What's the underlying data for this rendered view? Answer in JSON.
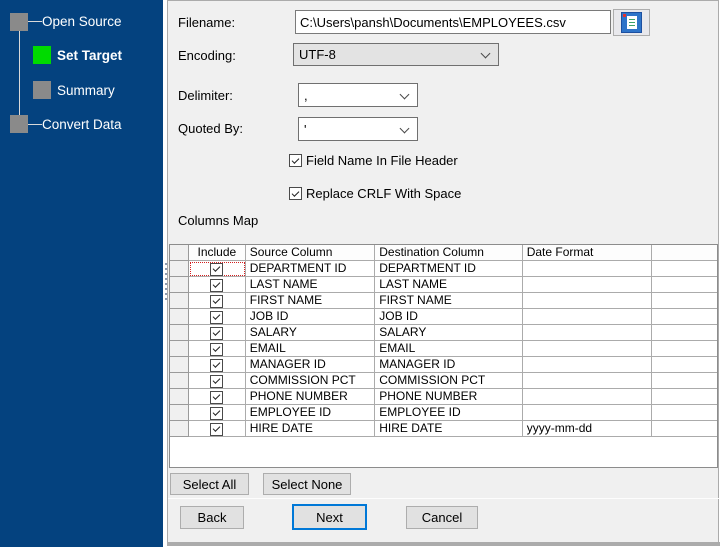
{
  "sidebar": {
    "bg_color": "#04427F",
    "active_color": "#00DB00",
    "inactive_color": "#8A8A8A",
    "steps": [
      {
        "label": "Open Source",
        "state": "done"
      },
      {
        "label": "Set Target",
        "state": "active"
      },
      {
        "label": "Summary",
        "state": "pending"
      },
      {
        "label": "Convert Data",
        "state": "pending"
      }
    ]
  },
  "form": {
    "filename": {
      "label": "Filename:",
      "value": "C:\\Users\\pansh\\Documents\\EMPLOYEES.csv",
      "browse_icon": "document-icon"
    },
    "encoding": {
      "label": "Encoding:",
      "value": "UTF-8"
    },
    "delimiter": {
      "label": "Delimiter:",
      "value": ","
    },
    "quoted_by": {
      "label": "Quoted By:",
      "value": "'"
    },
    "checkboxes": [
      {
        "label": "Field Name In File Header",
        "checked": true
      },
      {
        "label": "Replace CRLF With Space",
        "checked": true
      }
    ]
  },
  "columns_map": {
    "title": "Columns Map",
    "headers": [
      "Include",
      "Source Column",
      "Destination Column",
      "Date Format"
    ],
    "rows": [
      {
        "include": true,
        "source": "DEPARTMENT ID",
        "destination": "DEPARTMENT ID",
        "date_format": "",
        "focused": true
      },
      {
        "include": true,
        "source": "LAST NAME",
        "destination": "LAST NAME",
        "date_format": ""
      },
      {
        "include": true,
        "source": "FIRST NAME",
        "destination": "FIRST NAME",
        "date_format": ""
      },
      {
        "include": true,
        "source": "JOB ID",
        "destination": "JOB ID",
        "date_format": ""
      },
      {
        "include": true,
        "source": "SALARY",
        "destination": "SALARY",
        "date_format": ""
      },
      {
        "include": true,
        "source": "EMAIL",
        "destination": "EMAIL",
        "date_format": ""
      },
      {
        "include": true,
        "source": "MANAGER ID",
        "destination": "MANAGER ID",
        "date_format": ""
      },
      {
        "include": true,
        "source": "COMMISSION PCT",
        "destination": "COMMISSION PCT",
        "date_format": ""
      },
      {
        "include": true,
        "source": "PHONE NUMBER",
        "destination": "PHONE NUMBER",
        "date_format": ""
      },
      {
        "include": true,
        "source": "EMPLOYEE ID",
        "destination": "EMPLOYEE ID",
        "date_format": ""
      },
      {
        "include": true,
        "source": "HIRE DATE",
        "destination": "HIRE DATE",
        "date_format": "yyyy-mm-dd"
      }
    ]
  },
  "table_buttons": {
    "select_all": "Select All",
    "select_none": "Select None"
  },
  "footer": {
    "back": "Back",
    "next": "Next",
    "cancel": "Cancel"
  }
}
